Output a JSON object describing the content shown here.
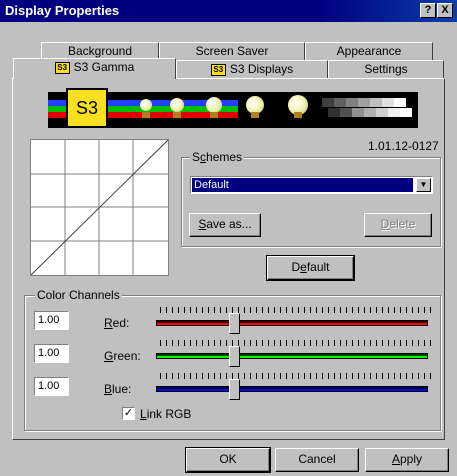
{
  "window": {
    "title": "Display Properties"
  },
  "titlebar_buttons": {
    "help": "?",
    "close": "X"
  },
  "tabs": {
    "row1": [
      "Background",
      "Screen Saver",
      "Appearance"
    ],
    "row2": [
      {
        "label": "S3 Gamma",
        "icon": "S3"
      },
      {
        "label": "S3 Displays",
        "icon": "S3"
      },
      {
        "label": "Settings"
      }
    ],
    "active": "S3 Gamma"
  },
  "logo": {
    "text": "S3"
  },
  "version": "1.01.12-0127",
  "schemes": {
    "group_label_prefix": "S",
    "group_label_ul": "c",
    "group_label_suffix": "hemes",
    "selected": "Default",
    "save_as_ul": "S",
    "save_as_rest": "ave as...",
    "delete_ul": "D",
    "delete_rest": "elete"
  },
  "default_button": {
    "prefix": "D",
    "ul": "e",
    "suffix": "fault"
  },
  "color_channels": {
    "label": "Color Channels",
    "channels": [
      {
        "key": "red",
        "ul": "R",
        "rest": "ed:",
        "value": "1.00",
        "color": "#ff0000",
        "dark": "#400000",
        "level": 0.29
      },
      {
        "key": "green",
        "ul": "G",
        "rest": "reen:",
        "value": "1.00",
        "color": "#00ff00",
        "dark": "#004000",
        "level": 0.29
      },
      {
        "key": "blue",
        "ul": "B",
        "rest": "lue:",
        "value": "1.00",
        "color": "#0000ff",
        "dark": "#000040",
        "level": 0.29
      }
    ],
    "link_ul": "L",
    "link_rest": "ink RGB",
    "link_checked": true
  },
  "footer": {
    "ok": "OK",
    "cancel": "Cancel",
    "apply_ul": "A",
    "apply_rest": "pply"
  },
  "colors": {
    "titlebar": "#000080",
    "face": "#c0c0c0",
    "selection": "#000080",
    "s3_yellow": "#f8e020"
  }
}
